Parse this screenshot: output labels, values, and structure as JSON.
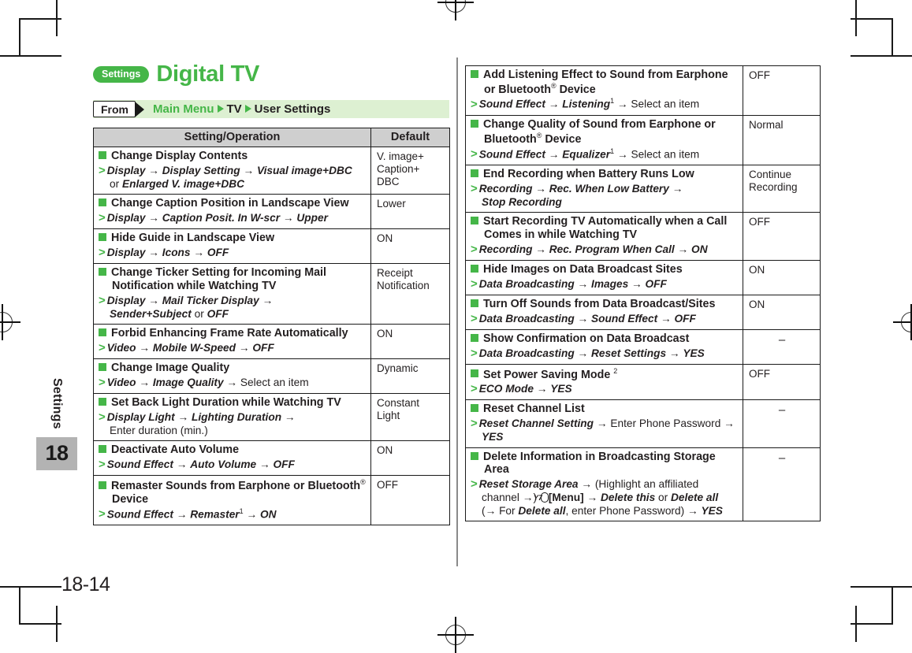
{
  "sidebar": {
    "chapter_name": "Settings",
    "chapter_number": "18"
  },
  "header": {
    "badge": "Settings",
    "title": "Digital TV",
    "from_label": "From",
    "path": [
      {
        "text": "Main Menu",
        "color": "green"
      },
      {
        "text": "TV",
        "color": "black"
      },
      {
        "text": "User Settings",
        "color": "black"
      }
    ]
  },
  "table": {
    "col_operation": "Setting/Operation",
    "col_default": "Default"
  },
  "footer": {
    "page": "18-14"
  },
  "colors": {
    "accent_green": "#45b648",
    "from_bar_bg": "#ddf0d2",
    "header_bg": "#cfcfcf",
    "tab_gray": "#b3b3b3"
  },
  "left_rows": [
    {
      "title": "Change Display Contents",
      "path_html": "<span class=\"bi\">Display</span> <span class=\"arw\">→</span> <span class=\"bi\">Display Setting</span> <span class=\"arw\">→</span> <span class=\"bi\">Visual image+DBC</span><br><span class=\"pl\">or</span> <span class=\"bi\">Enlarged V. image+DBC</span>",
      "default": "V. image+<br>Caption+<br>DBC",
      "default_align": "top"
    },
    {
      "title": "Change Caption Position in Landscape View",
      "path_html": "<span class=\"bi\">Display</span> <span class=\"arw\">→</span> <span class=\"bi\">Caption Posit. In W-scr</span> <span class=\"arw\">→</span> <span class=\"bi\">Upper</span>",
      "default": "Lower",
      "default_align": "mid"
    },
    {
      "title": "Hide Guide in Landscape View",
      "path_html": "<span class=\"bi\">Display</span> <span class=\"arw\">→</span> <span class=\"bi\">Icons</span> <span class=\"arw\">→</span> <span class=\"bi\">OFF</span>",
      "default": "ON",
      "default_align": "mid"
    },
    {
      "title": "Change Ticker Setting for Incoming Mail Notification while Watching TV",
      "path_html": "<span class=\"bi\">Display</span> <span class=\"arw\">→</span> <span class=\"bi\">Mail Ticker Display</span> <span class=\"arw\">→</span><br><span class=\"bi\">Sender+Subject</span> <span class=\"pl\">or</span> <span class=\"bi\">OFF</span>",
      "default": "Receipt<br>Notification",
      "default_align": "mid"
    },
    {
      "title": "Forbid Enhancing Frame Rate Automatically",
      "path_html": "<span class=\"bi\">Video</span> <span class=\"arw\">→</span> <span class=\"bi\">Mobile W-Speed</span> <span class=\"arw\">→</span> <span class=\"bi\">OFF</span>",
      "default": "ON",
      "default_align": "mid"
    },
    {
      "title": "Change Image Quality",
      "path_html": "<span class=\"bi\">Video</span> <span class=\"arw\">→</span> <span class=\"bi\">Image Quality</span> <span class=\"arw\">→</span> <span class=\"pl\">Select an item</span>",
      "default": "Dynamic",
      "default_align": "mid"
    },
    {
      "title": "Set Back Light Duration while Watching TV",
      "path_html": "<span class=\"bi\">Display Light</span> <span class=\"arw\">→</span> <span class=\"bi\">Lighting Duration</span> <span class=\"arw\">→</span><br><span class=\"pl\">Enter duration (min.)</span>",
      "default": "Constant Light",
      "default_align": "mid"
    },
    {
      "title": "Deactivate Auto Volume",
      "path_html": "<span class=\"bi\">Sound Effect</span> <span class=\"arw\">→</span> <span class=\"bi\">Auto Volume</span> <span class=\"arw\">→</span> <span class=\"bi\">OFF</span>",
      "default": "ON",
      "default_align": "mid"
    },
    {
      "title": "Remaster Sounds from Earphone or Bluetooth<sup>®</sup> Device",
      "path_html": "<span class=\"bi\">Sound Effect</span> <span class=\"arw\">→</span> <span class=\"bi\">Remaster</span><sup>1</sup> <span class=\"arw\">→</span> <span class=\"bi\">ON</span>",
      "default": "OFF",
      "default_align": "mid"
    }
  ],
  "right_rows": [
    {
      "title": "Add Listening Effect to Sound from Earphone or Bluetooth<sup>®</sup> Device",
      "path_html": "<span class=\"bi\">Sound Effect</span> <span class=\"arw\">→</span> <span class=\"bi\">Listening</span><sup>1</sup> <span class=\"arw\">→</span> <span class=\"pl\">Select an item</span>",
      "default": "OFF",
      "default_align": "mid"
    },
    {
      "title": "Change Quality of Sound from Earphone or Bluetooth<sup>®</sup> Device",
      "path_html": "<span class=\"bi\">Sound Effect</span> <span class=\"arw\">→</span> <span class=\"bi\">Equalizer</span><sup>1</sup> <span class=\"arw\">→</span> <span class=\"pl\">Select an item</span>",
      "default": "Normal",
      "default_align": "mid"
    },
    {
      "title": "End Recording when Battery Runs Low",
      "path_html": "<span class=\"bi\">Recording</span> <span class=\"arw\">→</span> <span class=\"bi\">Rec. When Low Battery</span> <span class=\"arw\">→</span><br><span class=\"bi\">Stop Recording</span>",
      "default": "Continue<br>Recording",
      "default_align": "mid"
    },
    {
      "title": "Start Recording TV Automatically when a Call Comes in while Watching TV",
      "path_html": "<span class=\"bi\">Recording</span> <span class=\"arw\">→</span> <span class=\"bi\">Rec. Program When Call</span> <span class=\"arw\">→</span> <span class=\"bi\">ON</span>",
      "default": "OFF",
      "default_align": "mid"
    },
    {
      "title": "Hide Images on Data Broadcast Sites",
      "path_html": "<span class=\"bi\">Data Broadcasting</span> <span class=\"arw\">→</span> <span class=\"bi\">Images</span> <span class=\"arw\">→</span> <span class=\"bi\">OFF</span>",
      "default": "ON",
      "default_align": "mid"
    },
    {
      "title": "Turn Off Sounds from Data Broadcast/Sites",
      "path_html": "<span class=\"bi\">Data Broadcasting</span> <span class=\"arw\">→</span> <span class=\"bi\">Sound Effect</span> <span class=\"arw\">→</span> <span class=\"bi\">OFF</span>",
      "default": "ON",
      "default_align": "mid"
    },
    {
      "title": "Show Confirmation on Data Broadcast",
      "path_html": "<span class=\"bi\">Data Broadcasting</span> <span class=\"arw\">→</span> <span class=\"bi\">Reset Settings</span> <span class=\"arw\">→</span> <span class=\"bi\">YES</span>",
      "default": "–",
      "default_align": "dash"
    },
    {
      "title": "Set Power Saving Mode <sup>2</sup>",
      "path_html": "<span class=\"bi\">ECO Mode</span> <span class=\"arw\">→</span> <span class=\"bi\">YES</span>",
      "default": "OFF",
      "default_align": "mid"
    },
    {
      "title": "Reset Channel List",
      "path_html": "<span class=\"bi\">Reset Channel Setting</span> <span class=\"arw\">→</span> <span class=\"pl\">Enter Phone Password</span> <span class=\"arw\">→</span> <span class=\"bi\">YES</span>",
      "default": "–",
      "default_align": "dash"
    },
    {
      "title": "Delete Information in Broadcasting Storage Area",
      "path_html": "<span class=\"bi\">Reset Storage Area</span> <span class=\"arw\">→</span> <span class=\"pl\">(Highlight an affiliated</span><br><span class=\"pl\">channel</span> <span class=\"arw\">→</span><span class=\"pl\">)</span> <span class=\"menukey\" data-name=\"menu-key-icon\">Y7</span><span class=\"b\">[Menu]</span> <span class=\"arw\">→</span> <span class=\"bi\">Delete this</span> <span class=\"pl\">or</span> <span class=\"bi\">Delete all</span><br><span class=\"pl\">(</span><span class=\"arw\">→</span> <span class=\"pl\">For</span> <span class=\"bi\">Delete all</span><span class=\"pl\">, enter Phone Password)</span> <span class=\"arw\">→</span> <span class=\"bi\">YES</span>",
      "default": "–",
      "default_align": "dash"
    }
  ]
}
